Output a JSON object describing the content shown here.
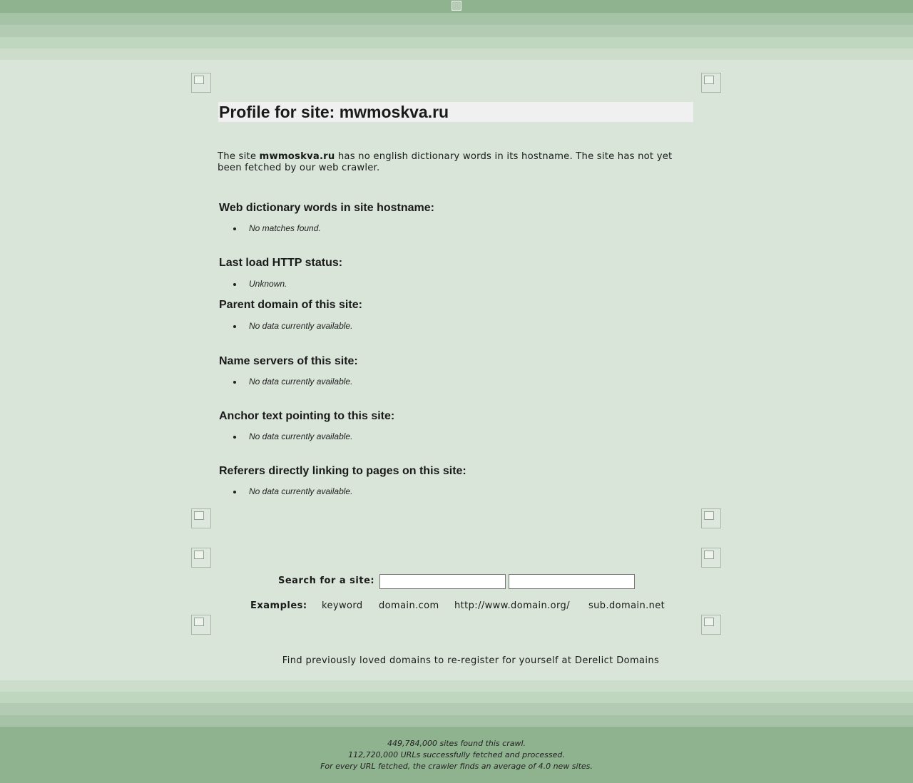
{
  "profile": {
    "title": "Profile for site: mwmoskva.ru",
    "intro_before": "The site ",
    "intro_site": "mwmoskva.ru",
    "intro_after": " has no english dictionary words in its hostname. The site has not yet been fetched by our web crawler."
  },
  "sections": [
    {
      "heading": "Web dictionary words in site hostname:",
      "item": "No matches found."
    },
    {
      "heading": "Last load HTTP status:",
      "item": "Unknown."
    },
    {
      "heading": "Parent domain of this site:",
      "item": "No data currently available."
    },
    {
      "heading": "Name servers of this site:",
      "item": "No data currently available."
    },
    {
      "heading": "Anchor text pointing to this site:",
      "item": "No data currently available."
    },
    {
      "heading": "Referers directly linking to pages on this site:",
      "item": "No data currently available."
    }
  ],
  "search": {
    "label": "Search for a site:",
    "input1_value": "",
    "input2_value": ""
  },
  "examples": {
    "label": "Examples:",
    "items": [
      "keyword",
      "domain.com",
      "http://www.domain.org/",
      "sub.domain.net"
    ]
  },
  "promo": "Find previously loved domains to re-register for yourself at Derelict Domains",
  "footer": {
    "line1": "449,784,000 sites found this crawl.",
    "line2": "112,720,000 URLs successfully fetched and processed.",
    "line3": "For every URL fetched, the crawler finds an average of 4.0 new sites."
  },
  "colors": {
    "page_bg": "#d9e5d9",
    "stripe_dark": "#8fb28f",
    "stripe_mid": "#a7c3a7",
    "stripe_light": "#bfd6bf",
    "title_box": "#f0f0f0"
  },
  "icons": {
    "broken_image": "broken-image-icon"
  }
}
